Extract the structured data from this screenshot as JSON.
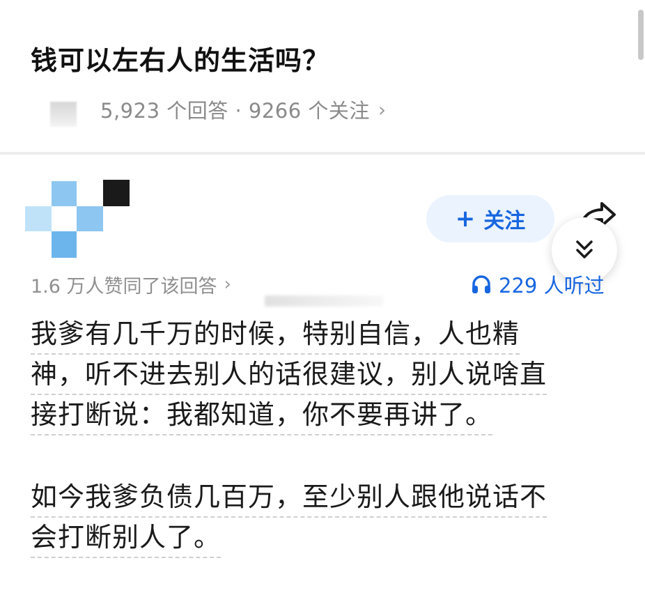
{
  "question": {
    "title": "钱可以左右人的生活吗？",
    "stats": "5,923 个回答 · 9266 个关注",
    "stats_chevron": "›"
  },
  "author": {
    "follow_plus": "+",
    "follow_label": "关注"
  },
  "answer_meta": {
    "approve_text": "1.6 万人赞同了该回答",
    "approve_chevron": "›",
    "listen_text": "229 人听过"
  },
  "answer": {
    "paragraphs": [
      {
        "lines": [
          "我爹有几千万的时候，特别自信，人也精",
          "神，听不进去别人的话很建议，别人说啥直",
          "接打断说：我都知道，你不要再讲了。"
        ]
      },
      {
        "lines": [
          "如今我爹负债几百万，至少别人跟他说话不",
          "会打断别人了。"
        ]
      }
    ]
  },
  "colors": {
    "accent_blue": "#1766e0",
    "follow_bg": "#ebf3ff",
    "meta_gray": "#8a8a8a"
  },
  "icons": {
    "share": "share-arrow-icon",
    "collapse": "double-chevron-down-icon",
    "listen": "headphones-icon"
  }
}
